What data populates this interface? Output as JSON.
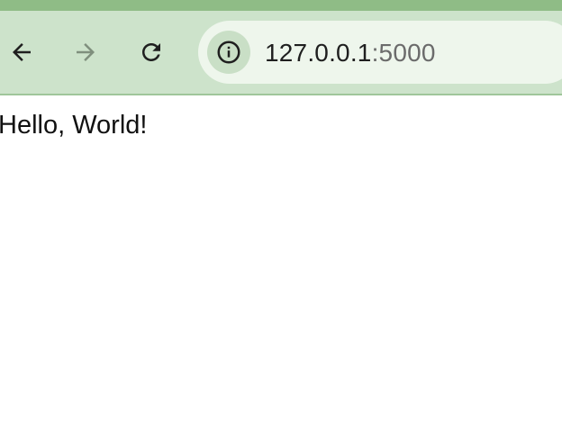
{
  "browser": {
    "address_bar": {
      "host": "127.0.0.1",
      "port": ":5000"
    },
    "icons": {
      "back": "arrow-left-icon",
      "forward": "arrow-right-icon",
      "reload": "reload-icon",
      "site_info": "info-icon"
    },
    "colors": {
      "accent_strip": "#8fbc86",
      "toolbar": "#cde3cb",
      "omnibox": "#eef6ec"
    }
  },
  "page": {
    "body_text": "Hello, World!"
  }
}
